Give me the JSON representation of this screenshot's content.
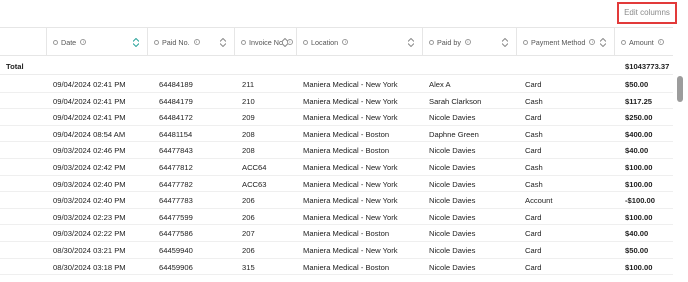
{
  "toolbar": {
    "edit_columns_label": "Edit columns"
  },
  "columns": [
    {
      "label": "Date"
    },
    {
      "label": "Paid No."
    },
    {
      "label": "Invoice No"
    },
    {
      "label": "Location"
    },
    {
      "label": "Paid by"
    },
    {
      "label": "Payment Method"
    },
    {
      "label": "Amount"
    }
  ],
  "total": {
    "label": "Total",
    "amount": "$1043773.37"
  },
  "rows": [
    {
      "date": "09/04/2024 02:41 PM",
      "paid_no": "64484189",
      "invoice_no": "211",
      "location": "Maniera Medical - New York",
      "paid_by": "Alex A",
      "method": "Card",
      "amount": "$50.00"
    },
    {
      "date": "09/04/2024 02:41 PM",
      "paid_no": "64484179",
      "invoice_no": "210",
      "location": "Maniera Medical - New York",
      "paid_by": "Sarah Clarkson",
      "method": "Cash",
      "amount": "$117.25"
    },
    {
      "date": "09/04/2024 02:41 PM",
      "paid_no": "64484172",
      "invoice_no": "209",
      "location": "Maniera Medical - New York",
      "paid_by": "Nicole Davies",
      "method": "Card",
      "amount": "$250.00"
    },
    {
      "date": "09/04/2024 08:54 AM",
      "paid_no": "64481154",
      "invoice_no": "208",
      "location": "Maniera Medical - Boston",
      "paid_by": "Daphne Green",
      "method": "Cash",
      "amount": "$400.00"
    },
    {
      "date": "09/03/2024 02:46 PM",
      "paid_no": "64477843",
      "invoice_no": "208",
      "location": "Maniera Medical - Boston",
      "paid_by": "Nicole Davies",
      "method": "Card",
      "amount": "$40.00"
    },
    {
      "date": "09/03/2024 02:42 PM",
      "paid_no": "64477812",
      "invoice_no": "ACC64",
      "location": "Maniera Medical - New York",
      "paid_by": "Nicole Davies",
      "method": "Cash",
      "amount": "$100.00"
    },
    {
      "date": "09/03/2024 02:40 PM",
      "paid_no": "64477782",
      "invoice_no": "ACC63",
      "location": "Maniera Medical - New York",
      "paid_by": "Nicole Davies",
      "method": "Cash",
      "amount": "$100.00"
    },
    {
      "date": "09/03/2024 02:40 PM",
      "paid_no": "64477783",
      "invoice_no": "206",
      "location": "Maniera Medical - New York",
      "paid_by": "Nicole Davies",
      "method": "Account",
      "amount": "-$100.00"
    },
    {
      "date": "09/03/2024 02:23 PM",
      "paid_no": "64477599",
      "invoice_no": "206",
      "location": "Maniera Medical - New York",
      "paid_by": "Nicole Davies",
      "method": "Card",
      "amount": "$100.00"
    },
    {
      "date": "09/03/2024 02:22 PM",
      "paid_no": "64477586",
      "invoice_no": "207",
      "location": "Maniera Medical - Boston",
      "paid_by": "Nicole Davies",
      "method": "Card",
      "amount": "$40.00"
    },
    {
      "date": "08/30/2024 03:21 PM",
      "paid_no": "64459940",
      "invoice_no": "206",
      "location": "Maniera Medical - New York",
      "paid_by": "Nicole Davies",
      "method": "Card",
      "amount": "$50.00"
    },
    {
      "date": "08/30/2024 03:18 PM",
      "paid_no": "64459906",
      "invoice_no": "315",
      "location": "Maniera Medical - Boston",
      "paid_by": "Nicole Davies",
      "method": "Card",
      "amount": "$100.00"
    }
  ],
  "colors": {
    "highlight_border": "#e23a3a",
    "sort_active": "#2aa39a"
  }
}
